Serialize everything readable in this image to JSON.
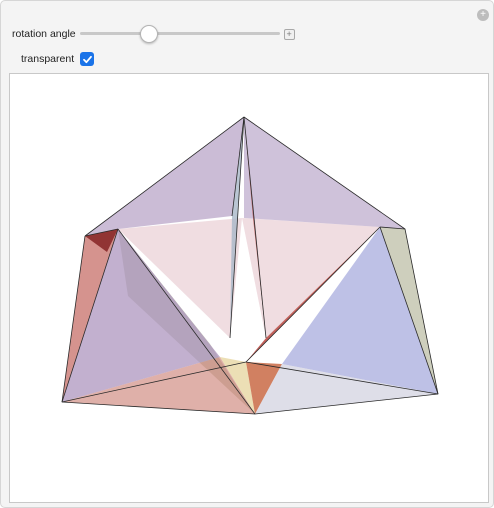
{
  "controls": {
    "rotation_angle": {
      "label": "rotation angle",
      "value_fraction": 0.34
    },
    "transparent": {
      "label": "transparent",
      "checked": true
    }
  },
  "icons": {
    "corner": "gear-icon",
    "plus": "plus-icon",
    "check": "checkmark-icon"
  },
  "colors": {
    "checkbox": "#1a73e8",
    "purple_faces": "#a88fbb",
    "pink_faces": "#e4c1c8",
    "red_faces": "#b33a32",
    "blue_faces": "#9b9fd8",
    "olive_faces": "#b3b59a",
    "yellow_faces": "#e6d49c"
  }
}
